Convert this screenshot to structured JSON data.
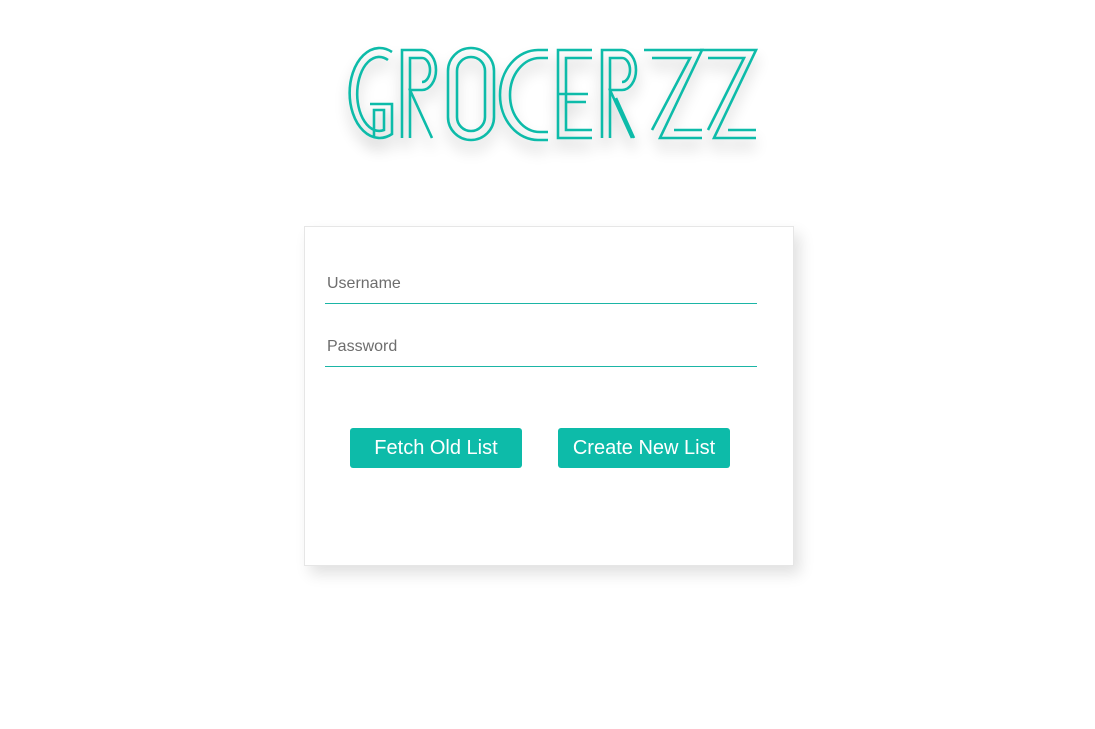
{
  "brand": {
    "logo_text": "GROCERZZ",
    "color": "#0dbba9"
  },
  "login": {
    "username_placeholder": "Username",
    "username_value": "",
    "password_placeholder": "Password",
    "password_value": "",
    "fetch_button_label": "Fetch Old List",
    "create_button_label": "Create New List",
    "accent_color": "#0dbba9"
  }
}
